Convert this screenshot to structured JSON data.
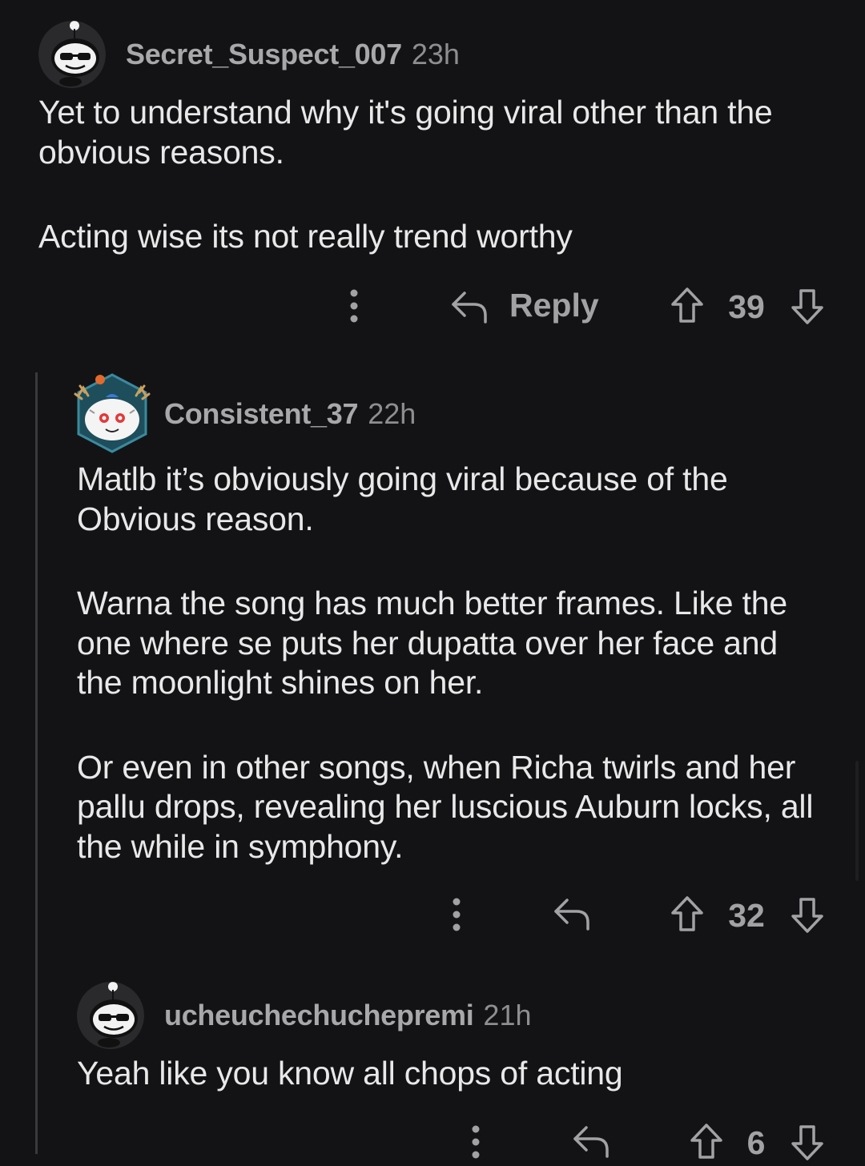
{
  "comments": [
    {
      "username": "Secret_Suspect_007",
      "time": "23h",
      "paragraphs": [
        "Yet to understand why it's going viral other than the obvious reasons.",
        "Acting wise its not really trend worthy"
      ],
      "reply_label": "Reply",
      "score": "39",
      "avatar_icon": "snoo-sunglasses-avatar-icon"
    },
    {
      "username": "Consistent_37",
      "time": "22h",
      "paragraphs": [
        "Matlb it’s obviously going viral because of the Obvious reason.",
        "Warna the song has much better frames. Like the one where se puts her dupatta over her face and the moonlight shines on her.",
        "Or even in other songs, when Richa twirls and her pallu drops, revealing her luscious Auburn locks, all the while in symphony."
      ],
      "score": "32",
      "avatar_icon": "snoo-antlers-avatar-icon"
    },
    {
      "username": "ucheuchechuchepremi",
      "time": "21h",
      "paragraphs": [
        "Yeah like you know all chops of acting"
      ],
      "score": "6",
      "avatar_icon": "snoo-sunglasses-avatar-icon"
    }
  ],
  "colors": {
    "background": "#131316",
    "username": "#a8a8aa",
    "body": "#e8e8e8",
    "action": "#a2a2a5",
    "thread_line": "#3a3a3e"
  }
}
